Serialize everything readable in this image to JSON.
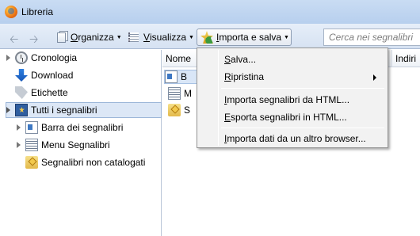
{
  "window": {
    "title": "Libreria"
  },
  "toolbar": {
    "back_icon": "back-arrow-icon",
    "forward_icon": "forward-arrow-icon",
    "organize": {
      "accel": "O",
      "rest": "rganizza"
    },
    "view": {
      "accel": "V",
      "rest": "isualizza"
    },
    "import": {
      "accel": "I",
      "rest": "mporta e salva"
    },
    "search_placeholder": "Cerca nei segnalibri"
  },
  "sidebar": {
    "items": [
      {
        "label": "Cronologia",
        "icon": "clock-icon",
        "expandable": true
      },
      {
        "label": "Download",
        "icon": "download-icon",
        "expandable": false
      },
      {
        "label": "Etichette",
        "icon": "tag-icon",
        "expandable": false
      },
      {
        "label": "Tutti i segnalibri",
        "icon": "all-bookmarks-icon",
        "expandable": true,
        "selected": true
      },
      {
        "label": "Barra dei segnalibri",
        "icon": "bookmarks-bar-icon",
        "expandable": true
      },
      {
        "label": "Menu Segnalibri",
        "icon": "bookmarks-menu-icon",
        "expandable": true
      },
      {
        "label": "Segnalibri non catalogati",
        "icon": "unsorted-bookmarks-icon",
        "expandable": false
      }
    ]
  },
  "content": {
    "columns": [
      "Nome",
      "Indiri"
    ],
    "rows": [
      {
        "label": "B",
        "icon": "bookmarks-bar-icon",
        "selected": true
      },
      {
        "label": "M",
        "icon": "bookmarks-menu-icon",
        "selected": false
      },
      {
        "label": "S",
        "icon": "unsorted-bookmarks-icon",
        "selected": false
      }
    ]
  },
  "menu": {
    "items": [
      {
        "accel": "S",
        "rest": "alva...",
        "submenu": false
      },
      {
        "accel": "R",
        "rest": "ipristina",
        "submenu": true
      },
      {
        "accel": "I",
        "rest": "mporta segnalibri da HTML...",
        "submenu": false
      },
      {
        "accel": "E",
        "rest": "sporta segnalibri in HTML...",
        "submenu": false
      },
      {
        "accel": "I",
        "rest": "mporta dati da un altro browser...",
        "submenu": false
      }
    ]
  }
}
